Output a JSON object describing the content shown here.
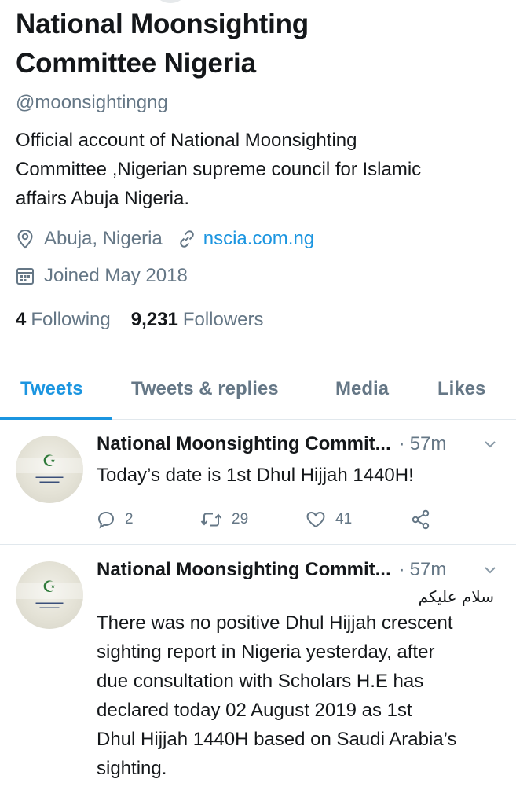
{
  "profile": {
    "name_line1": "National Moonsighting",
    "name_line2": "Committee Nigeria",
    "handle": "@moonsightingng",
    "bio_lines": [
      "Official account of National Moonsighting",
      "Committee ,Nigerian supreme council for Islamic",
      "affairs Abuja Nigeria."
    ],
    "location": "Abuja, Nigeria",
    "location_icon": "location-pin-icon",
    "website": "nscia.com.ng",
    "website_icon": "link-icon",
    "joined": "Joined May 2018",
    "joined_icon": "calendar-icon",
    "following_count": "4",
    "following_label": "Following",
    "followers_count": "9,231",
    "followers_label": "Followers"
  },
  "tabs": [
    {
      "label": "Tweets",
      "active": true
    },
    {
      "label": "Tweets & replies",
      "active": false
    },
    {
      "label": "Media",
      "active": false
    },
    {
      "label": "Likes",
      "active": false
    }
  ],
  "tweets": [
    {
      "author": "National Moonsighting Commit...",
      "dot": "·",
      "time": "57m",
      "text_lines": [
        "Today’s date is 1st Dhul Hijjah 1440H!"
      ],
      "replies": "2",
      "retweets": "29",
      "likes": "41"
    },
    {
      "author": "National Moonsighting Commit...",
      "dot": "·",
      "time": "57m",
      "arabic": "سلام عليكم",
      "text_lines": [
        "There was no positive Dhul Hijjah crescent",
        "sighting report in Nigeria yesterday, after",
        "due consultation with Scholars H.E has",
        "declared today 02 August 2019 as 1st",
        "Dhul Hijjah 1440H based on Saudi Arabia’s",
        "sighting."
      ]
    }
  ],
  "colors": {
    "accent": "#1b95e0",
    "text": "#14171a",
    "muted": "#657786",
    "divider": "#e1e8ed"
  }
}
